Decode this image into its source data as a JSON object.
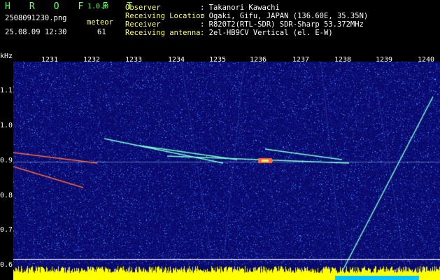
{
  "brand": {
    "name": "H R O F F T",
    "version": "1.0.0"
  },
  "file": {
    "name": "2508091230.png",
    "datetime": "25.08.09 12:30"
  },
  "meteor": {
    "label": "meteor",
    "count": "61"
  },
  "info": [
    {
      "label": "Observer",
      "value": ": Takanori Kawachi"
    },
    {
      "label": "Receiving Location",
      "value": ": Ogaki, Gifu, JAPAN (136.60E, 35.35N)"
    },
    {
      "label": "Receiver",
      "value": ": R820T2(RTL-SDR) SDR-Sharp 53.372MHz"
    },
    {
      "label": "Receiving antenna",
      "value": ": 2el-HB9CV Vertical (el. E-W)"
    }
  ],
  "axis": {
    "unit": "kHz",
    "time_ticks": [
      "1231",
      "1232",
      "1233",
      "1234",
      "1235",
      "1236",
      "1237",
      "1238",
      "1239",
      "1240"
    ],
    "freq_ticks": [
      "1.1",
      "1.0",
      "0.9",
      "0.8",
      "0.7",
      "0.6"
    ]
  },
  "colors": {
    "background": "#0a0a6e",
    "noise_dim": "#1a2aa8",
    "noise_bright": "#3a7aff",
    "echo": "#7cffcf",
    "echo_hot": "#ff6a3a",
    "level": "#ffff00",
    "level_base": "#00c8ff"
  }
}
